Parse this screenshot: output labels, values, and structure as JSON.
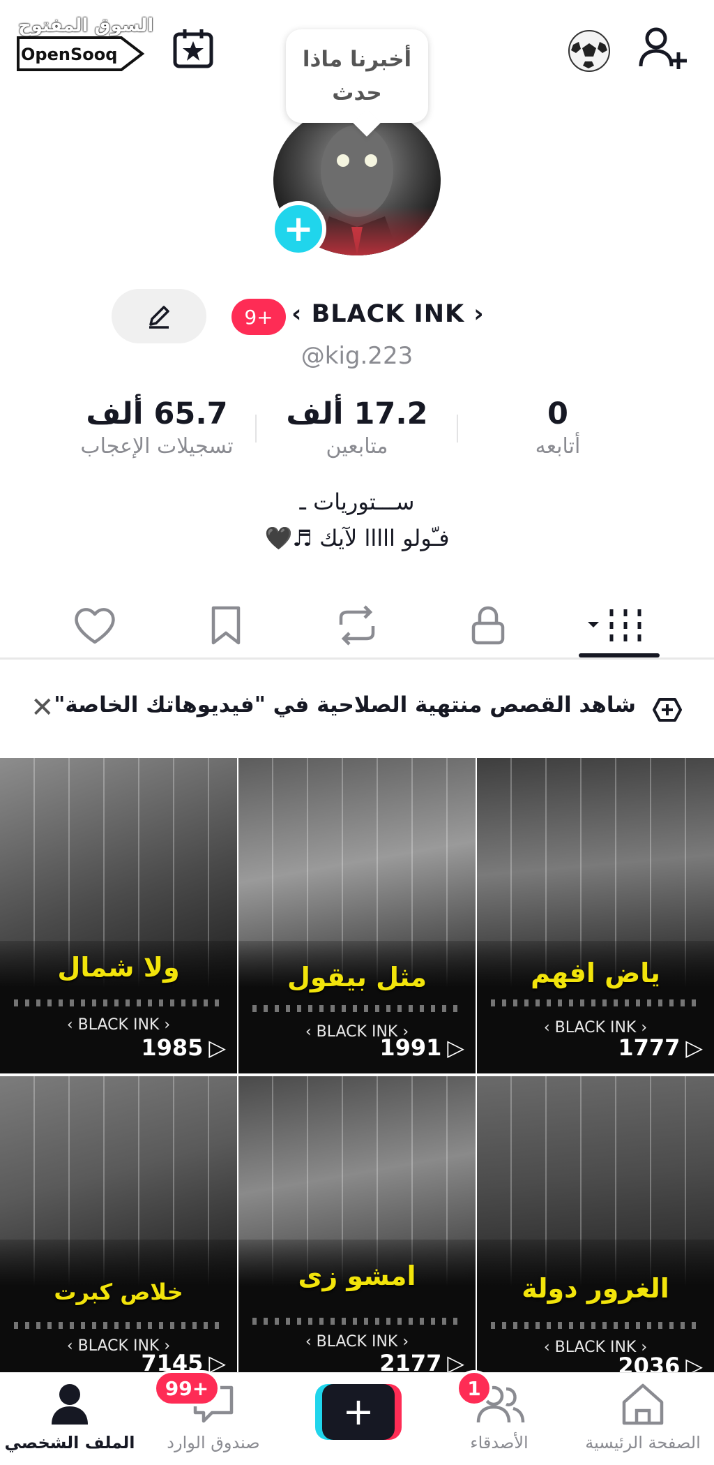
{
  "watermark": {
    "arabic": "السوق المفتوح",
    "brand": "OpenSooq"
  },
  "tooltip": {
    "text": "أخبرنا ماذا حدث"
  },
  "profile": {
    "notification_badge": "9+",
    "display_name": "‹ BLACK INK ›",
    "username": "@kig.223",
    "bio_line1": "ســـتوريات ـ",
    "bio_line2": "فـّولو ااااا لآيك ♬🖤"
  },
  "stats": {
    "likes_value": "65.7 ألف",
    "likes_label": "تسجيلات الإعجاب",
    "followers_value": "17.2 ألف",
    "followers_label": "متابعين",
    "following_value": "0",
    "following_label": "أتابعه"
  },
  "notice": {
    "text": "شاهد القصص منتهية الصلاحية في \"فيديوهاتك الخاصة\""
  },
  "videos": [
    {
      "caption": "ولا شمال",
      "brand": "‹ BLACK INK ›",
      "views": "1985"
    },
    {
      "caption": "مثل بيقول",
      "brand": "‹ BLACK INK ›",
      "views": "1991"
    },
    {
      "caption": "ياض افهم",
      "brand": "‹ BLACK INK ›",
      "views": "1777"
    },
    {
      "caption": "خلاص كبرت",
      "brand": "‹ BLACK INK ›",
      "views": "7145"
    },
    {
      "caption": "امشو زى",
      "brand": "‹ BLACK INK ›",
      "views": "2177"
    },
    {
      "caption": "الغرور دولة",
      "brand": "‹ BLACK INK ›",
      "views": "2036"
    }
  ],
  "nav": {
    "profile": "الملف الشخصي",
    "inbox": "صندوق الوارد",
    "inbox_badge": "99+",
    "friends": "الأصدقاء",
    "friends_badge": "1",
    "home": "الصفحة الرئيسية",
    "create": "+"
  },
  "colors": {
    "accent_red": "#fe2c55",
    "accent_cyan": "#20d5ec",
    "caption_yellow": "#f2e40b"
  }
}
